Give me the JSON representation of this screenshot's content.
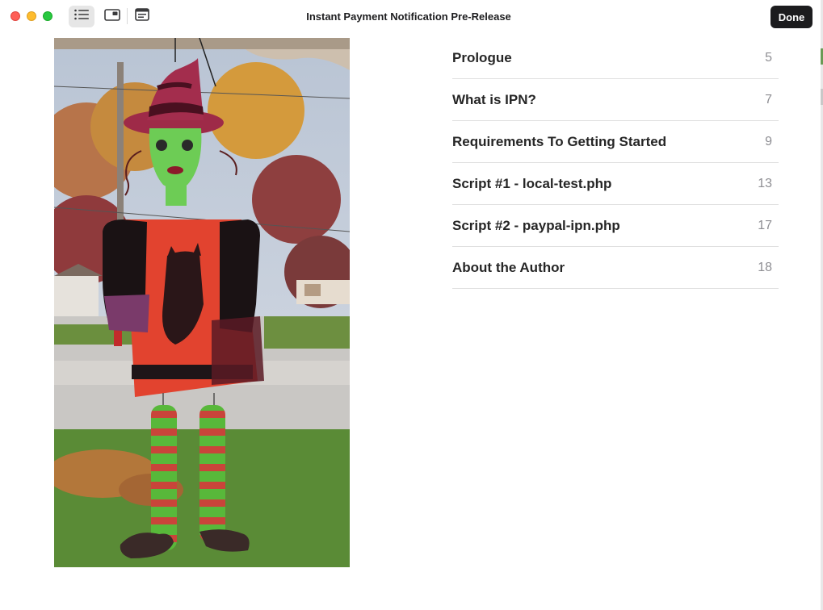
{
  "window": {
    "title": "Instant Payment Notification Pre-Release",
    "done_label": "Done"
  },
  "toolbar": {
    "buttons": [
      {
        "name": "table-of-contents",
        "icon": "list-icon",
        "active": true
      },
      {
        "name": "cover-view",
        "icon": "picture-in-picture-icon",
        "active": false
      },
      {
        "name": "description",
        "icon": "book-info-icon",
        "active": false
      }
    ]
  },
  "colors": {
    "close": "#fe5f57",
    "minimize": "#febc2e",
    "zoom": "#28c840",
    "done_bg": "#1c1c1e",
    "page_number": "#8e8e93"
  },
  "toc": {
    "items": [
      {
        "title": "Prologue",
        "page": "5"
      },
      {
        "title": "What is IPN?",
        "page": "7"
      },
      {
        "title": "Requirements To Getting Started",
        "page": "9"
      },
      {
        "title": "Script #1 - local-test.php",
        "page": "13"
      },
      {
        "title": "Script #2 - paypal-ipn.php",
        "page": "17"
      },
      {
        "title": "About the Author",
        "page": "18"
      }
    ]
  }
}
